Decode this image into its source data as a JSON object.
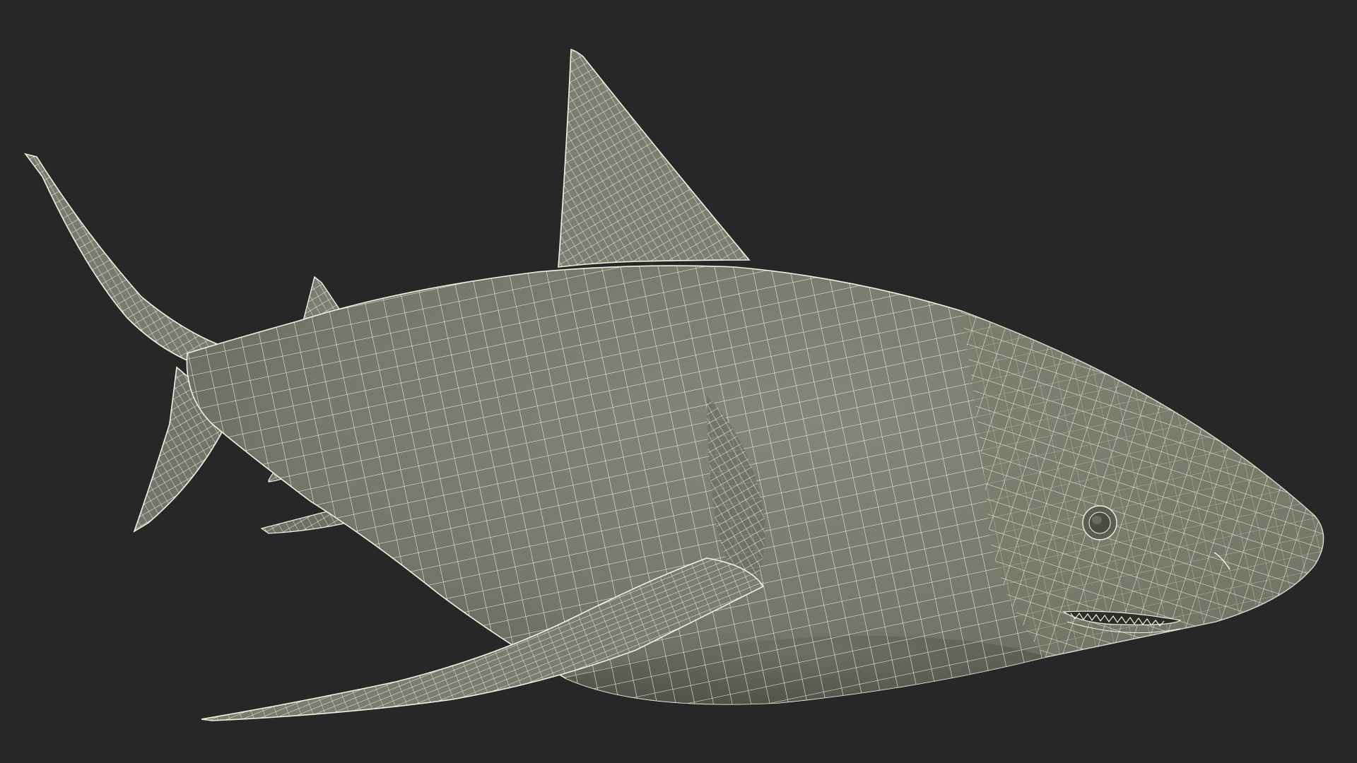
{
  "scene": {
    "background_color": "#272727",
    "subject": "shark-wireframe",
    "mesh_fill_color": "#77786b",
    "mesh_shadow_color": "#5d5e54",
    "mesh_highlight_color": "#8a8b7e",
    "wire_color": "#f4f1e2",
    "mouth_color": "#2c2c28",
    "eye_color": "#4a4b43"
  }
}
